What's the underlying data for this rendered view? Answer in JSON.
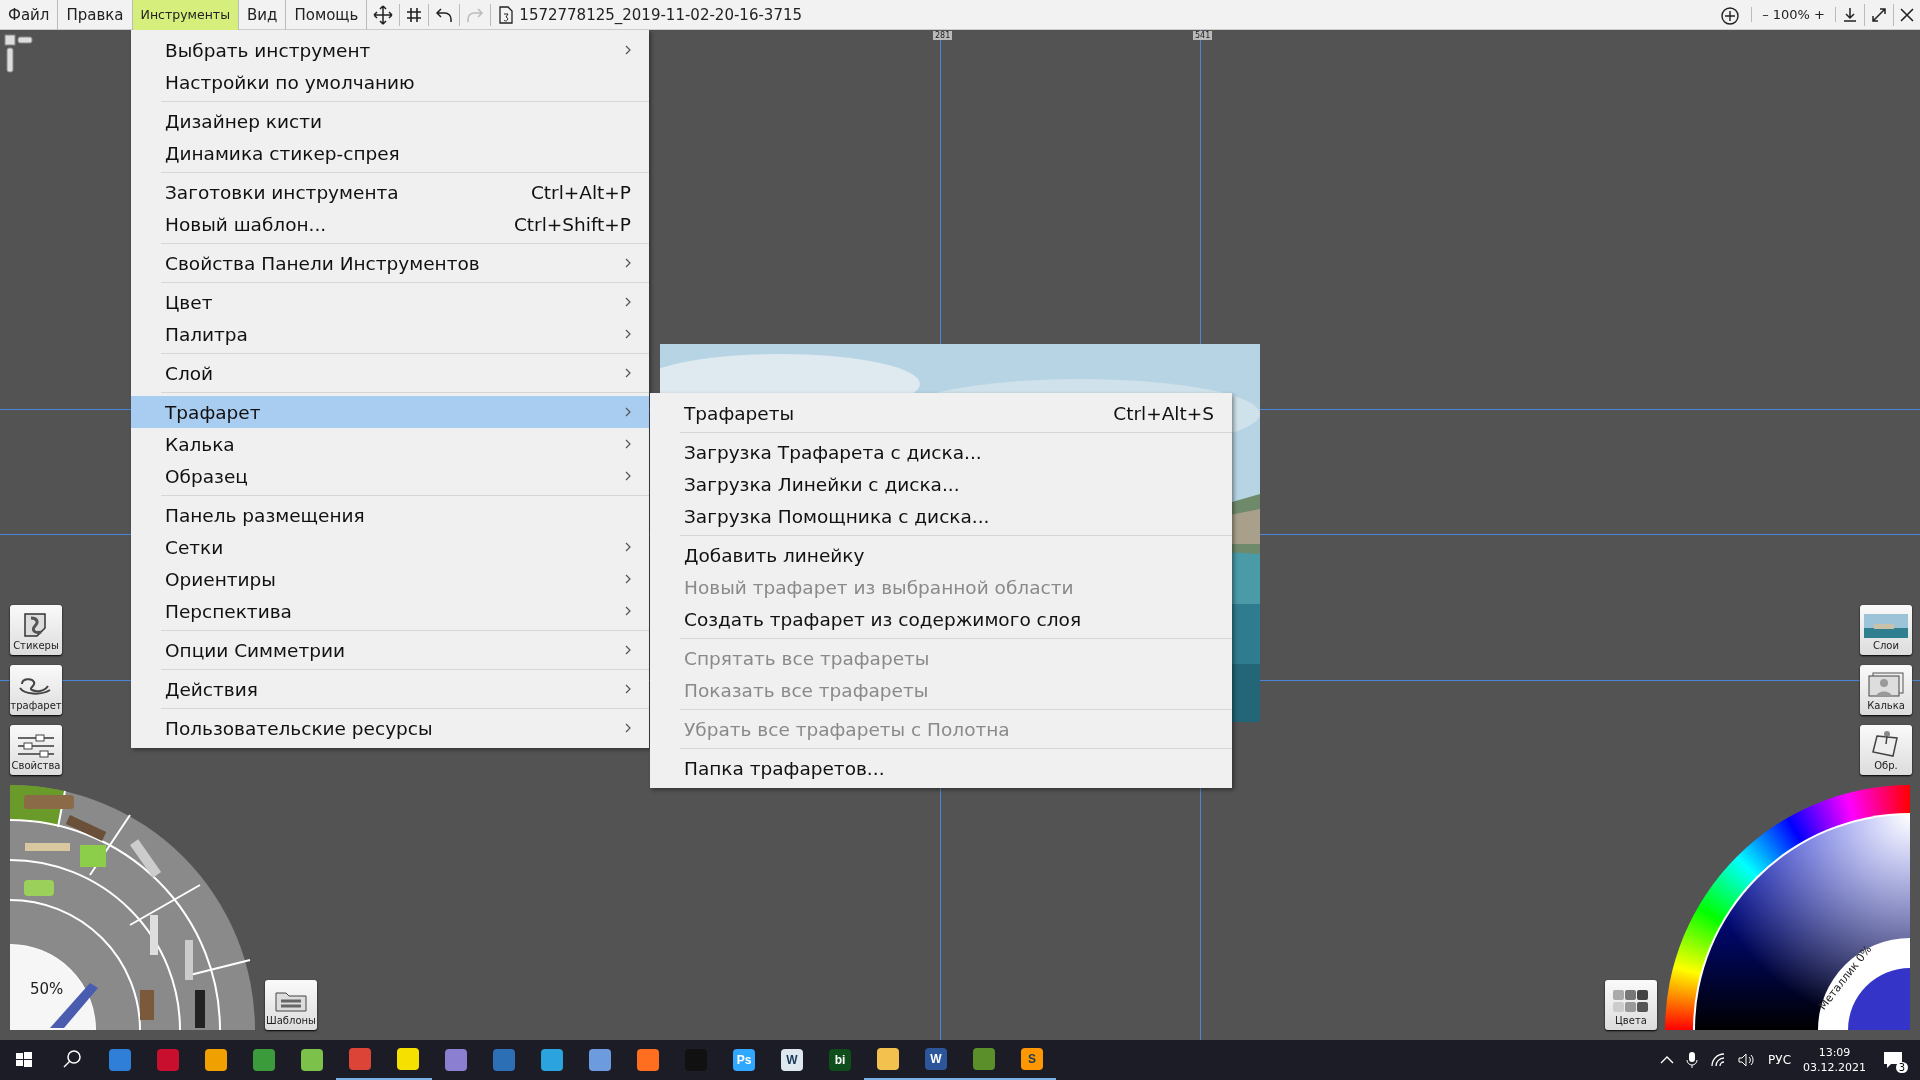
{
  "menubar": [
    {
      "label": "Файл",
      "selected": false
    },
    {
      "label": "Правка",
      "selected": false
    },
    {
      "label": "Инструменты",
      "selected": true
    },
    {
      "label": "Вид",
      "selected": false
    },
    {
      "label": "Помощь",
      "selected": false
    }
  ],
  "toolbar": {
    "redo_disabled": true,
    "document_title": "1572778125_2019-11-02-20-16-3715",
    "zoom": "– 100% +"
  },
  "rulers": [
    "281",
    "541"
  ],
  "menu": {
    "sections": [
      [
        {
          "label": "Выбрать инструмент",
          "submenu": true,
          "selected": false
        },
        {
          "label": "Настройки по умолчанию",
          "submenu": false,
          "selected": false
        }
      ],
      [
        {
          "label": "Дизайнер кисти",
          "submenu": false,
          "selected": false
        },
        {
          "label": "Динамика стикер-спрея",
          "submenu": false,
          "selected": false
        }
      ],
      [
        {
          "label": "Заготовки инструмента",
          "shortcut": "Ctrl+Alt+P",
          "submenu": false,
          "selected": false
        },
        {
          "label": "Новый шаблон...",
          "shortcut": "Ctrl+Shift+P",
          "submenu": false,
          "selected": false
        }
      ],
      [
        {
          "label": "Свойства Панели Инструментов",
          "submenu": true,
          "selected": false
        }
      ],
      [
        {
          "label": "Цвет",
          "submenu": true,
          "selected": false
        },
        {
          "label": "Палитра",
          "submenu": true,
          "selected": false
        }
      ],
      [
        {
          "label": "Слой",
          "submenu": true,
          "selected": false
        }
      ],
      [
        {
          "label": "Трафарет",
          "submenu": true,
          "selected": true
        },
        {
          "label": "Калька",
          "submenu": true,
          "selected": false
        },
        {
          "label": "Образец",
          "submenu": true,
          "selected": false
        }
      ],
      [
        {
          "label": "Панель размещения",
          "submenu": false,
          "selected": false
        },
        {
          "label": "Сетки",
          "submenu": true,
          "selected": false
        },
        {
          "label": "Ориентиры",
          "submenu": true,
          "selected": false
        },
        {
          "label": "Перспектива",
          "submenu": true,
          "selected": false
        }
      ],
      [
        {
          "label": "Опции Симметрии",
          "submenu": true,
          "selected": false
        }
      ],
      [
        {
          "label": "Действия",
          "submenu": true,
          "selected": false
        }
      ],
      [
        {
          "label": "Пользовательские ресурсы",
          "submenu": true,
          "selected": false
        }
      ]
    ]
  },
  "submenu": {
    "sections": [
      [
        {
          "label": "Трафареты",
          "shortcut": "Ctrl+Alt+S",
          "disabled": false
        }
      ],
      [
        {
          "label": "Загрузка Трафарета с диска...",
          "disabled": false
        },
        {
          "label": "Загрузка Линейки с диска...",
          "disabled": false
        },
        {
          "label": "Загрузка Помощника с диска...",
          "disabled": false
        }
      ],
      [
        {
          "label": "Добавить линейку",
          "disabled": false
        },
        {
          "label": "Новый трафарет из выбранной области",
          "disabled": true
        },
        {
          "label": "Создать трафарет из содержимого слоя",
          "disabled": false
        }
      ],
      [
        {
          "label": "Спрятать все трафареты",
          "disabled": true
        },
        {
          "label": "Показать все трафареты",
          "disabled": true
        }
      ],
      [
        {
          "label": "Убрать все трафареты с Полотна",
          "disabled": true
        }
      ],
      [
        {
          "label": "Папка трафаретов...",
          "disabled": false
        }
      ]
    ]
  },
  "left_panels": [
    {
      "label": "Стикеры",
      "kind": "sticker"
    },
    {
      "label": "трафарет",
      "kind": "stencil"
    },
    {
      "label": "Свойства",
      "kind": "sliders"
    }
  ],
  "brush_wheel": {
    "opacity": "50%"
  },
  "presets_button": "Шаблоны",
  "right_panels": [
    {
      "label": "Слои",
      "kind": "layers"
    },
    {
      "label": "Калька",
      "kind": "tracing"
    },
    {
      "label": "Обр.",
      "kind": "reference"
    }
  ],
  "colors_button": "Цвета",
  "color_wheel": {
    "metallic": "Металлик 0%"
  },
  "taskbar": {
    "apps": [
      {
        "color": "#2f7fd8",
        "active": false
      },
      {
        "color": "#c8102e",
        "active": false
      },
      {
        "color": "#f0a000",
        "active": false
      },
      {
        "color": "#3b9b3b",
        "active": false
      },
      {
        "color": "#7cc14a",
        "active": false
      },
      {
        "color": "#db4437",
        "active": true
      },
      {
        "color": "#f5e000",
        "active": true
      },
      {
        "color": "#8a7fd0",
        "active": false
      },
      {
        "color": "#2d6fb5",
        "active": false
      },
      {
        "color": "#2aa3de",
        "active": false
      },
      {
        "color": "#6c9be0",
        "active": false
      },
      {
        "color": "#ff6d1f",
        "active": false
      },
      {
        "color": "#111111",
        "active": false
      },
      {
        "label": "Ps",
        "color": "#31a8ff",
        "active": false
      },
      {
        "label": "W",
        "color": "#dfe8ee",
        "active": false
      },
      {
        "label": "bi",
        "color": "#0f4d1a",
        "active": false
      },
      {
        "color": "#f2c14e",
        "active": true
      },
      {
        "label": "W",
        "color": "#2b579a",
        "active": true
      },
      {
        "color": "#5a8f2a",
        "active": true
      },
      {
        "label": "S",
        "color": "#ff9800",
        "active": true
      }
    ],
    "language": "РУС",
    "time": "13:09",
    "date": "03.12.2021",
    "notifications": "3"
  }
}
